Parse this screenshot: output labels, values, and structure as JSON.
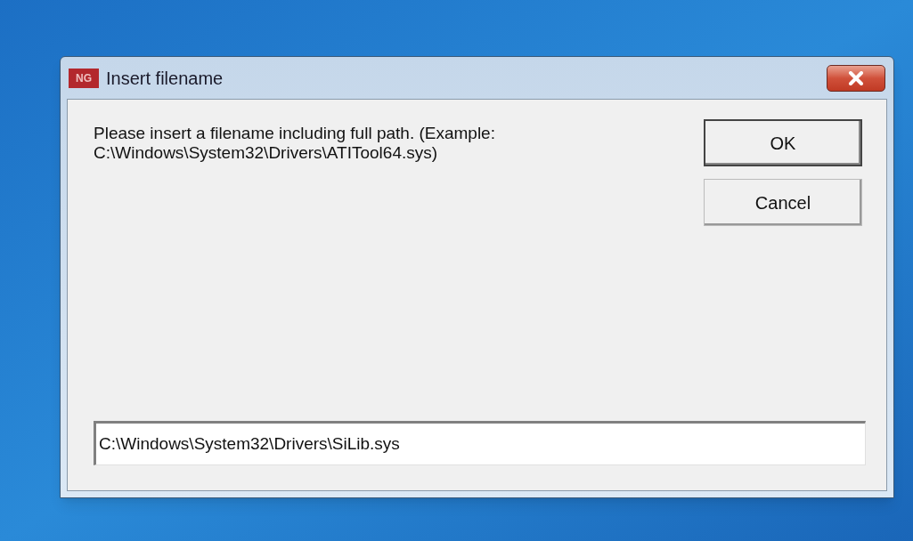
{
  "window": {
    "title": "Insert filename",
    "app_icon_text": "NG"
  },
  "message": "Please insert a filename including full path. (Example: C:\\Windows\\System32\\Drivers\\ATITool64.sys)",
  "buttons": [
    {
      "label": "OK",
      "default": true
    },
    {
      "label": "Cancel",
      "default": false
    }
  ],
  "filename_field": {
    "value": "C:\\Windows\\System32\\Drivers\\SiLib.sys "
  }
}
